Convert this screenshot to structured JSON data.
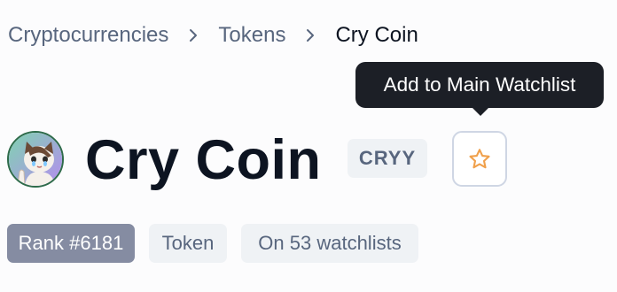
{
  "breadcrumb": {
    "items": [
      "Cryptocurrencies",
      "Tokens"
    ],
    "current": "Cry Coin",
    "separator_icon": "chevron-right-icon"
  },
  "tooltip": {
    "text": "Add to Main Watchlist"
  },
  "coin": {
    "avatar_icon": "cat-coin-logo",
    "name": "Cry Coin",
    "symbol": "CRYY"
  },
  "watchlist_button": {
    "icon": "star-outline-icon",
    "icon_color": "#f0a04b"
  },
  "tags": {
    "rank": "Rank #6181",
    "type": "Token",
    "watchlists": "On 53 watchlists"
  },
  "colors": {
    "text_primary": "#0d1421",
    "text_secondary": "#58667e",
    "rank_badge_bg": "#858ca2",
    "tag_bg": "#eff2f5",
    "tooltip_bg": "#1c1f26"
  }
}
